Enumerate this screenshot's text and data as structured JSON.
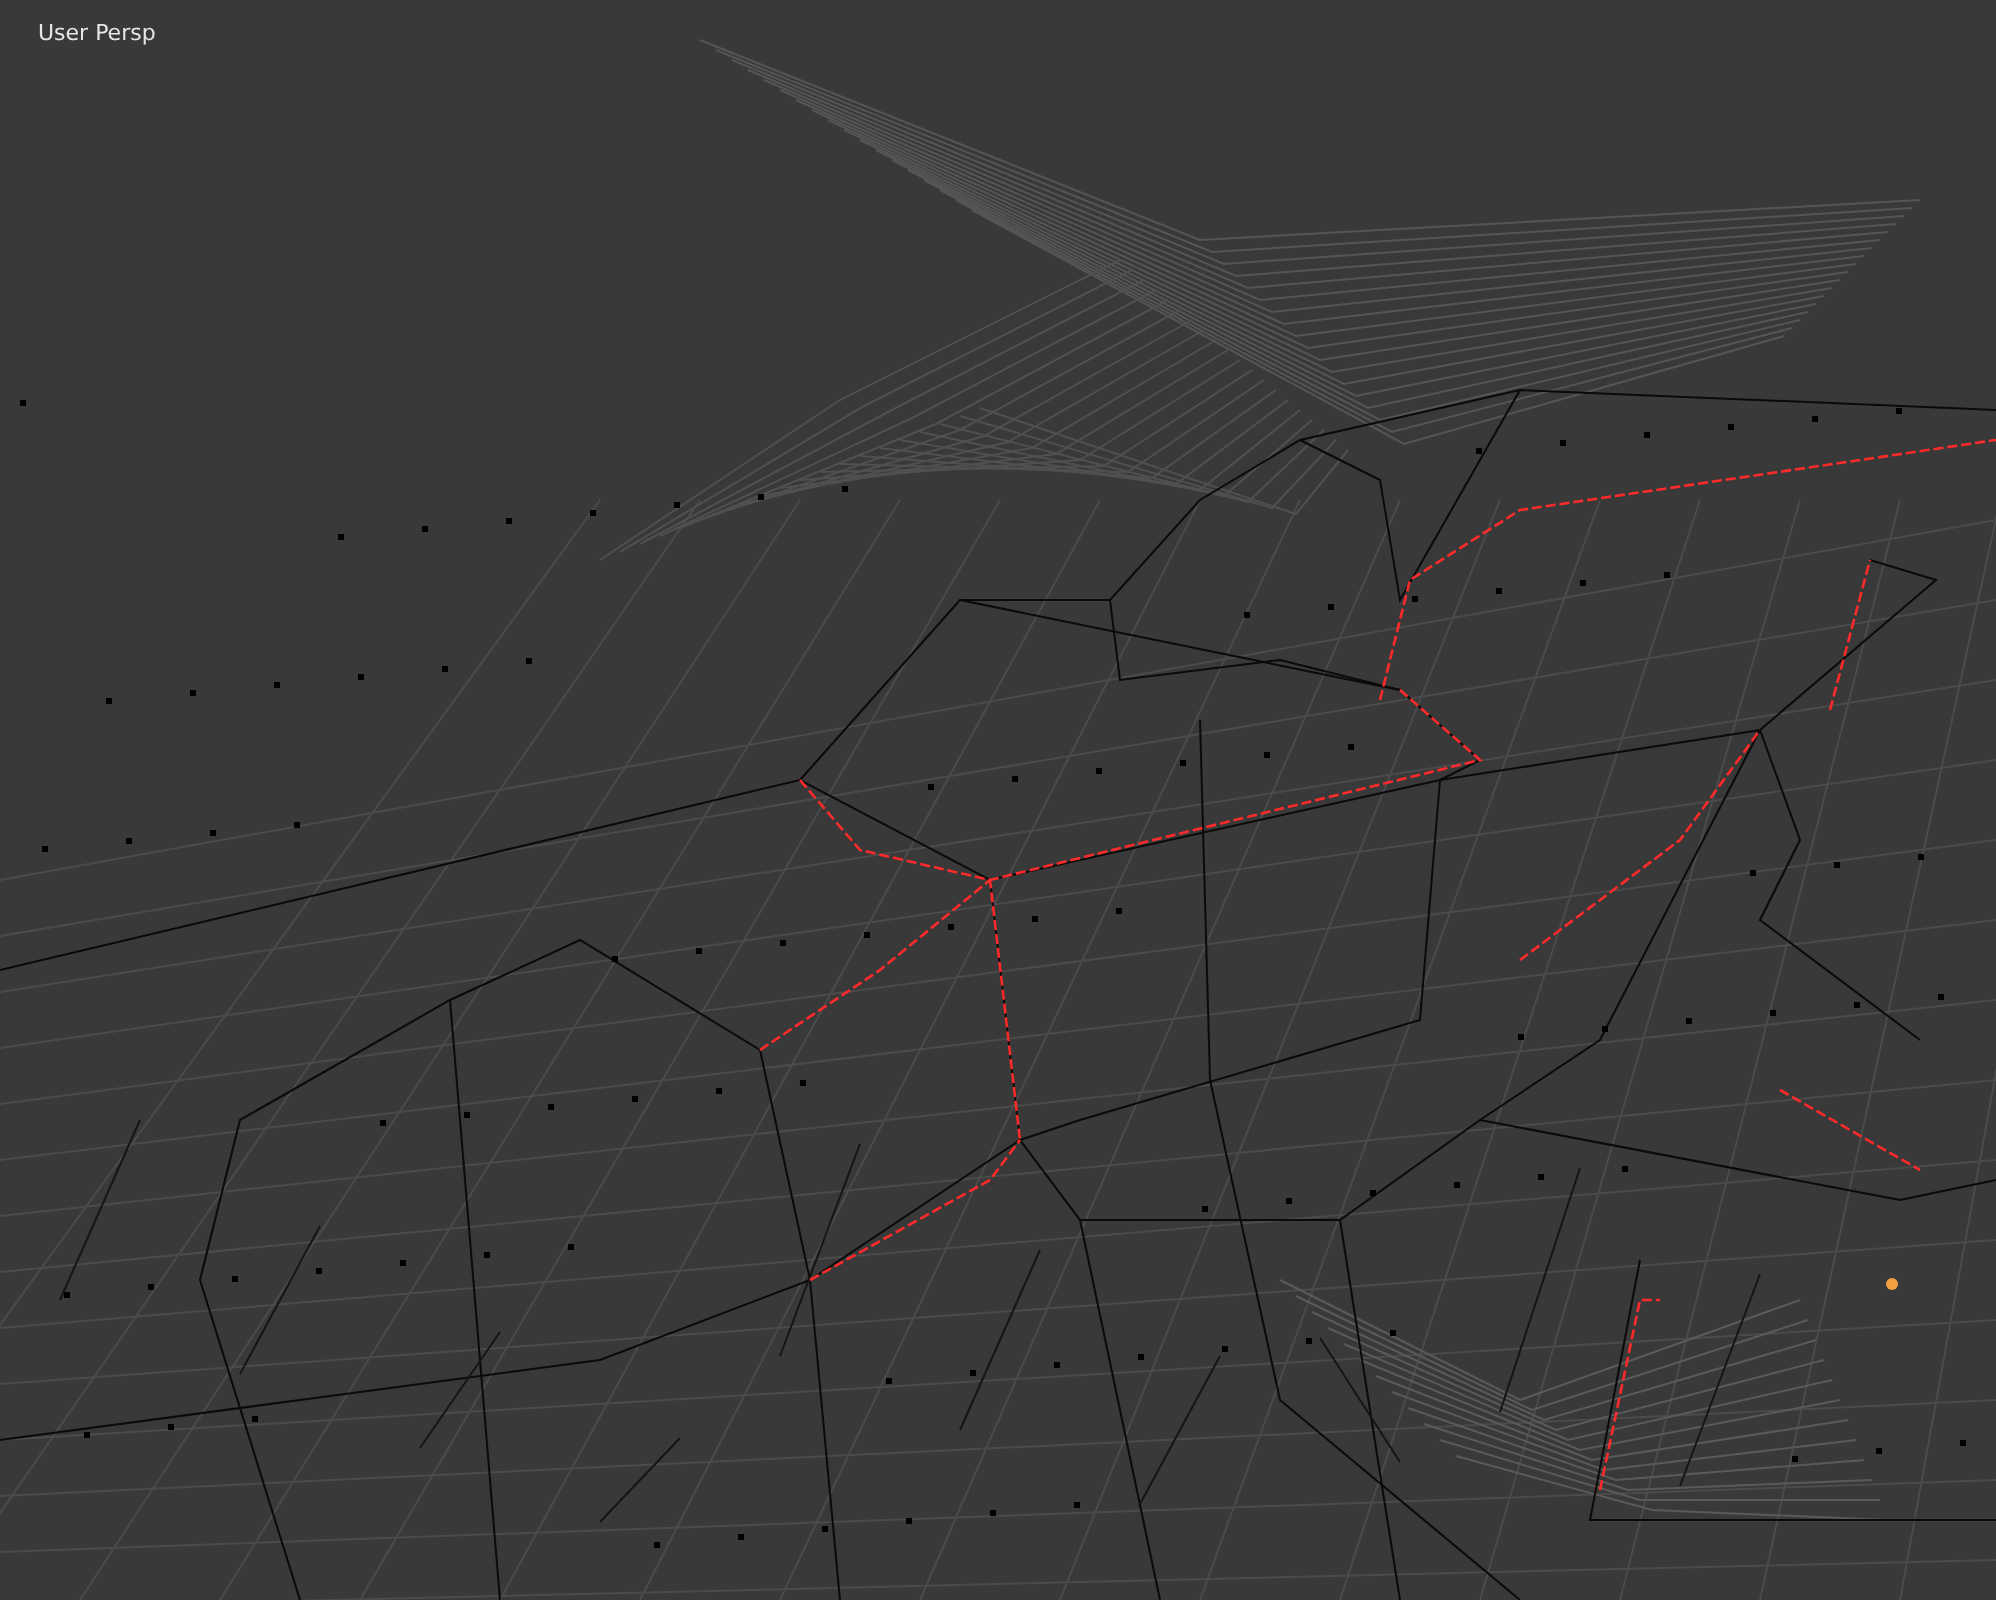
{
  "viewport": {
    "view_label": "User Persp"
  }
}
